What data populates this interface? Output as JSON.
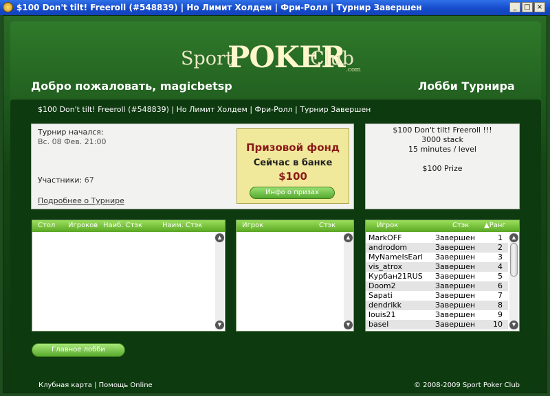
{
  "window": {
    "title": "$100 Don't tilt! Freeroll (#548839)  |  Но Лимит Холдем  |  Фри-Ролл  |  Турнир Завершен",
    "minimize": "_",
    "maximize": "□",
    "close": "×"
  },
  "logo": {
    "sport": "Sport",
    "poker": "POKER",
    "club": "Club",
    "com": ".com"
  },
  "header": {
    "welcome": "Добро пожаловать, magicbetsp",
    "lobby_title": "Лобби Турнира",
    "breadcrumb": "$100 Don't tilt! Freeroll (#548839)  |  Но Лимит Холдем  |  Фри-Ролл  |  Турнир Завершен"
  },
  "info": {
    "started_label": "Турнир начался:",
    "started_value": "Вс. 08 Фев. 21:00",
    "participants_label": "Участники:",
    "participants_value": "67",
    "more_link": "Подробнее о Турнире"
  },
  "prize": {
    "title": "Призовой фонд",
    "subtitle": "Сейчас в банке",
    "amount": "$100",
    "button": "Инфо о призах"
  },
  "description": {
    "line1": "$100 Don't tilt! Freeroll !!!",
    "line2": "3000 stack",
    "line3": "15 minutes / level",
    "line4": "",
    "line5": "$100 Prize"
  },
  "tables_list": {
    "col_table": "Стол",
    "col_players": "Игроков",
    "col_max_stack": "Наиб. Стэк",
    "col_min_stack": "Наим. Стэк"
  },
  "table_players_list": {
    "col_player": "Игрок",
    "col_stack": "Стэк"
  },
  "players_list": {
    "col_player": "Игрок",
    "col_stack": "Стэк",
    "col_rank": "▲Ранг",
    "rows": [
      {
        "name": "MarkOFF",
        "status": "Завершен",
        "rank": "1"
      },
      {
        "name": "androdom",
        "status": "Завершен",
        "rank": "2"
      },
      {
        "name": "MyNameIsEarl",
        "status": "Завершен",
        "rank": "3"
      },
      {
        "name": "vis_atrox",
        "status": "Завершен",
        "rank": "4"
      },
      {
        "name": "Курбан21RUS",
        "status": "Завершен",
        "rank": "5"
      },
      {
        "name": "Doom2",
        "status": "Завершен",
        "rank": "6"
      },
      {
        "name": "Sapati",
        "status": "Завершен",
        "rank": "7"
      },
      {
        "name": "dendrikk",
        "status": "Завершен",
        "rank": "8"
      },
      {
        "name": "louis21",
        "status": "Завершен",
        "rank": "9"
      },
      {
        "name": "basel",
        "status": "Завершен",
        "rank": "10"
      }
    ]
  },
  "main_lobby_button": "Главное лобби",
  "footer": {
    "links": "Клубная карта  |  Помощь Online",
    "copyright": "© 2008-2009 Sport Poker Club"
  }
}
